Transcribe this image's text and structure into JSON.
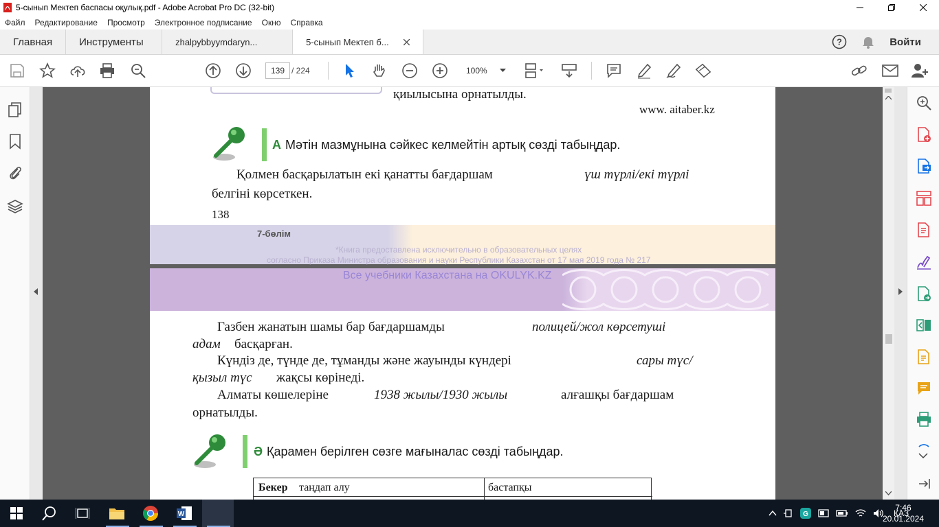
{
  "window": {
    "title": "5-сынып Мектеп баспасы оқулық.pdf - Adobe Acrobat Pro DC (32-bit)"
  },
  "menu": [
    "Файл",
    "Редактирование",
    "Просмотр",
    "Электронное подписание",
    "Окно",
    "Справка"
  ],
  "tabs": {
    "home": "Главная",
    "tools": "Инструменты",
    "doc1": "zhalpybbyymdaryn...",
    "doc2": "5-сынып Мектеп б...",
    "signin": "Войти"
  },
  "toolbar": {
    "page_current": "139",
    "page_total": "/  224",
    "zoom": "100%"
  },
  "pageA": {
    "line1": "қиылысына     орнатылды.",
    "url": "www. aitaber.kz",
    "task_a_letter": "А",
    "task_a": "Мәтін мазмұнына сәйкес келмейтін артық сөзді табыңдар.",
    "p1_normal": "Қолмен   басқарылатын    екі  қанатты   бағдаршам",
    "p1_italic": "үш түрлі/екі    түрлі",
    "p2": "белгіні   көрсеткен.",
    "page_number": "138",
    "section": "7-бөлім",
    "watermark1": "*Книга предоставлена исключительно в образовательных целях",
    "watermark2": "согласно Приказа Министра образования и науки Республики Казахстан от 17 мая 2019 года № 217"
  },
  "pageB": {
    "banner": "Все учебники Казахстана на OKULYK.KZ",
    "l1_normal": "Газбен  жанатын   шамы  бар  бағдаршамды",
    "l1_italic": "полицей/жол     көрсетуші",
    "l2_italic": "адам",
    "l2_normal": "басқарған.",
    "l3_normal": "Күндіз  де,  түнде  де,  тұманды   және  жауынды   күндері",
    "l3_italic": "сары  түс/",
    "l4_italic": "қызыл   түс",
    "l4_normal": "жақсы   көрінеді.",
    "l5_normal": "Алматы   көшелеріне",
    "l5_italic": "1938  жылы/1930     жылы",
    "l5_tail": "алғашқы    бағдаршам",
    "l6": "орнатылды.",
    "task_b_letter": "Ә",
    "task_b": "Қарамен берілген сөзге мағыналас сөзді табыңдар.",
    "table_c1_bold": "Бекер",
    "table_c1_rest": "таңдап   алу",
    "table_c2": "бастапқы"
  },
  "taskbar": {
    "lang": "ҚАЗ",
    "time": "7:46",
    "date": "20.01.2024"
  },
  "colors": {
    "accent_green": "#2e8b3a",
    "banner_purple": "#c8a9d6",
    "acrobat_red": "#d9201c",
    "taskbar_bg": "#0e1621"
  }
}
